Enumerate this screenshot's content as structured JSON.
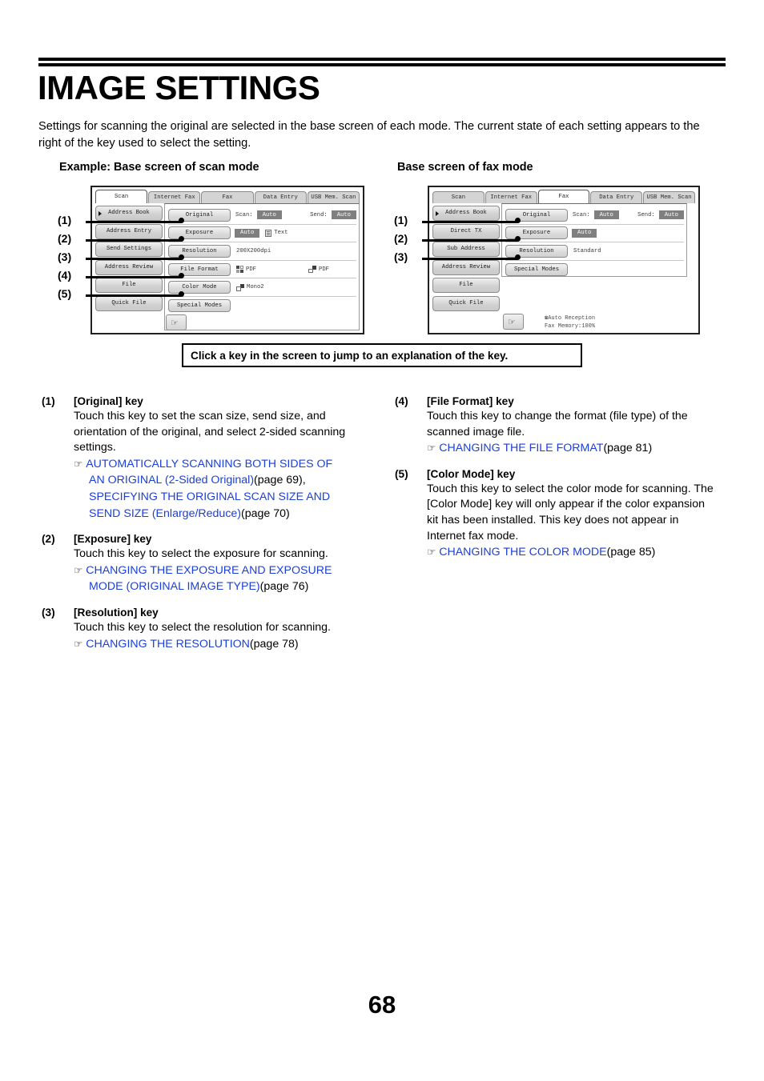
{
  "document": {
    "title": "IMAGE SETTINGS",
    "intro": "Settings for scanning the original are selected in the base screen of each mode. The current state of each setting appears to the right of the key used to select the setting.",
    "page_number": "68"
  },
  "examples": {
    "scan_caption": "Example: Base screen of scan mode",
    "fax_caption": "Base screen of fax mode"
  },
  "hint": {
    "text": "Click a key in the screen to jump to an explanation of the key."
  },
  "scan_screen": {
    "tabs": [
      {
        "label": "Scan",
        "active": true
      },
      {
        "label": "Internet Fax",
        "active": false
      },
      {
        "label": "Fax",
        "active": false
      },
      {
        "label": "Data Entry",
        "active": false
      },
      {
        "label": "USB Mem. Scan",
        "active": false
      }
    ],
    "left_keys": [
      {
        "label": "Address Book",
        "arrow": true
      },
      {
        "label": "Address Entry",
        "arrow": false
      },
      {
        "label": "Send Settings",
        "arrow": false
      },
      {
        "label": "Address Review",
        "arrow": false
      },
      {
        "label": "File",
        "arrow": false
      },
      {
        "label": "Quick File",
        "arrow": false
      }
    ],
    "rows": [
      {
        "key": "Original",
        "scan_label": "Scan:",
        "scan_value": "Auto",
        "send_label": "Send:",
        "send_value": "Auto"
      },
      {
        "key": "Exposure",
        "value_chip": "Auto",
        "icon": "text-document-icon",
        "icon_label": "Text"
      },
      {
        "key": "Resolution",
        "plain_value": "200X200dpi"
      },
      {
        "key": "File Format",
        "icon1": "color-quad-icon",
        "icon1_label": "PDF",
        "icon2": "mono-squares-icon",
        "icon2_label": "PDF"
      },
      {
        "key": "Color Mode",
        "icon1": "mono-squares-icon",
        "icon1_label": "Mono2"
      },
      {
        "key": "Special Modes"
      }
    ],
    "send_key_icon": "send-hand-icon"
  },
  "fax_screen": {
    "tabs": [
      {
        "label": "Scan",
        "active": false
      },
      {
        "label": "Internet Fax",
        "active": false
      },
      {
        "label": "Fax",
        "active": true
      },
      {
        "label": "Data Entry",
        "active": false
      },
      {
        "label": "USB Mem. Scan",
        "active": false
      }
    ],
    "left_keys": [
      {
        "label": "Address Book",
        "arrow": true
      },
      {
        "label": "Direct TX",
        "arrow": false
      },
      {
        "label": "Sub Address",
        "arrow": false
      },
      {
        "label": "Address Review",
        "arrow": false
      },
      {
        "label": "File",
        "arrow": false
      },
      {
        "label": "Quick File",
        "arrow": false
      }
    ],
    "rows": [
      {
        "key": "Original",
        "scan_label": "Scan:",
        "scan_value": "Auto",
        "send_label": "Send:",
        "send_value": "Auto"
      },
      {
        "key": "Exposure",
        "value_chip": "Auto"
      },
      {
        "key": "Resolution",
        "plain_value": "Standard"
      },
      {
        "key": "Special Modes"
      }
    ],
    "status": {
      "line1": "Auto Reception",
      "line2": "Fax Memory:100%",
      "icon": "phone-ring-icon"
    },
    "send_key_icon": "send-hand-icon"
  },
  "callouts": {
    "scan": [
      "(1)",
      "(2)",
      "(3)",
      "(4)",
      "(5)"
    ],
    "fax": [
      "(1)",
      "(2)",
      "(3)"
    ]
  },
  "explanations": {
    "left": [
      {
        "number": "(1)",
        "title": "[Original] key",
        "body": "Touch this key to set the scan size, send size, and orientation of the original, and select 2-sided scanning settings.",
        "refs": [
          {
            "pointer": true,
            "link": "AUTOMATICALLY SCANNING BOTH SIDES OF",
            "page": ""
          },
          {
            "pointer": false,
            "link": "AN ORIGINAL (2-Sided Original)",
            "page": " (page 69),"
          },
          {
            "pointer": false,
            "link": "SPECIFYING THE ORIGINAL SCAN SIZE AND",
            "page": ""
          },
          {
            "pointer": false,
            "link": "SEND SIZE (Enlarge/Reduce)",
            "page": " (page 70)"
          }
        ]
      },
      {
        "number": "(2)",
        "title": "[Exposure] key",
        "body": "Touch this key to select the exposure for scanning.",
        "refs": [
          {
            "pointer": true,
            "link": "CHANGING THE EXPOSURE AND EXPOSURE",
            "page": ""
          },
          {
            "pointer": false,
            "link": "MODE (ORIGINAL IMAGE TYPE)",
            "page": " (page 76)"
          }
        ]
      },
      {
        "number": "(3)",
        "title": "[Resolution] key",
        "body": "Touch this key to select the resolution for scanning.",
        "refs": [
          {
            "pointer": true,
            "link": "CHANGING THE RESOLUTION",
            "page": " (page 78)"
          }
        ]
      }
    ],
    "right": [
      {
        "number": "(4)",
        "title": "[File Format] key",
        "body": "Touch this key to change the format (file type) of the scanned image file.",
        "refs": [
          {
            "pointer": true,
            "link": "CHANGING THE FILE FORMAT",
            "page": " (page 81)"
          }
        ]
      },
      {
        "number": "(5)",
        "title": "[Color Mode] key",
        "body": "Touch this key to select the color mode for scanning. The [Color Mode] key will only appear if the color expansion kit has been installed. This key does not appear in Internet fax mode.",
        "refs": [
          {
            "pointer": true,
            "link": "CHANGING THE COLOR MODE",
            "page": " (page 85)"
          }
        ]
      }
    ]
  },
  "colors": {
    "link": "#1b3fd8",
    "chip_bg": "#7f7f7f",
    "key_bg": "#dcdcdc"
  }
}
